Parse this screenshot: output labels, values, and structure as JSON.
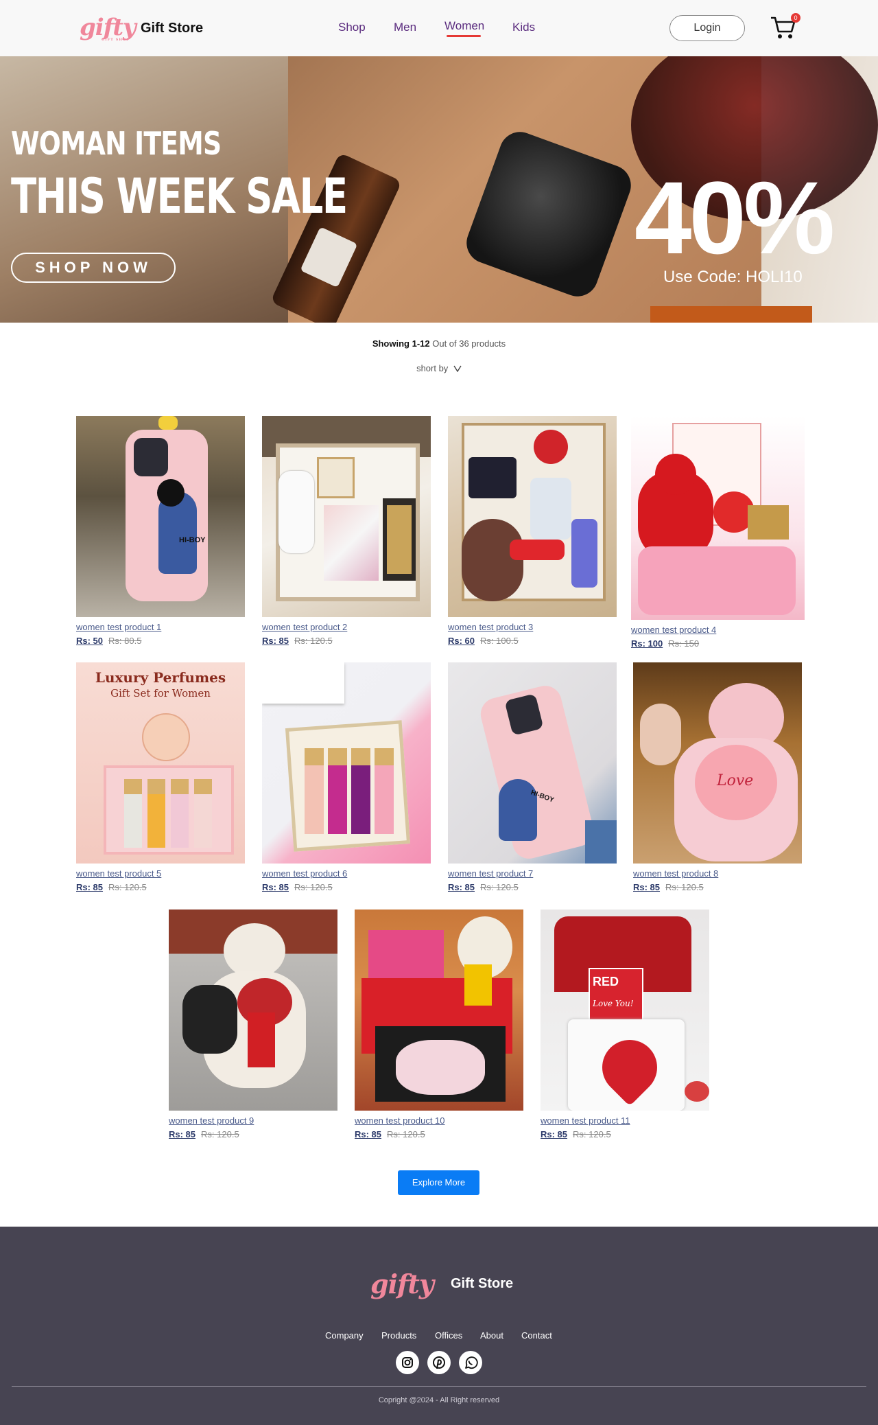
{
  "header": {
    "logo_text": "gifty",
    "logo_tag": "GIFT SHOP",
    "brand": "Gift Store",
    "nav": [
      "Shop",
      "Men",
      "Women",
      "Kids"
    ],
    "active_nav": "Women",
    "login_label": "Login",
    "cart_count": "0",
    "cart_icon": "cart-icon"
  },
  "hero": {
    "line1": "WOMAN ITEMS",
    "line2": "THIS WEEK SALE",
    "cta": "SHOP NOW",
    "discount": "40%",
    "code": "Use Code: HOLI10"
  },
  "listing": {
    "showing_bold": "Showing 1-12",
    "showing_rest": " Out of 36 products",
    "sort_label": "short by",
    "sort_icon": "chevron-down-icon"
  },
  "products": [
    {
      "name": "women test product 1",
      "price": "Rs: 50",
      "old": "Rs: 80.5"
    },
    {
      "name": "women test product 2",
      "price": "Rs: 85",
      "old": "Rs: 120.5"
    },
    {
      "name": "women test product 3",
      "price": "Rs: 60",
      "old": "Rs: 100.5"
    },
    {
      "name": "women test product 4",
      "price": "Rs: 100",
      "old": "Rs: 150"
    },
    {
      "name": "women test product 5",
      "price": "Rs: 85",
      "old": "Rs: 120.5"
    },
    {
      "name": "women test product 6",
      "price": "Rs: 85",
      "old": "Rs: 120.5"
    },
    {
      "name": "women test product 7",
      "price": "Rs: 85",
      "old": "Rs: 120.5"
    },
    {
      "name": "women test product 8",
      "price": "Rs: 85",
      "old": "Rs: 120.5"
    },
    {
      "name": "women test product 9",
      "price": "Rs: 85",
      "old": "Rs: 120.5"
    },
    {
      "name": "women test product 10",
      "price": "Rs: 85",
      "old": "Rs: 120.5"
    },
    {
      "name": "women test product 11",
      "price": "Rs: 85",
      "old": "Rs: 120.5"
    }
  ],
  "product_art": {
    "p5_title": "Luxury Perfumes",
    "p5_sub": "Gift Set for Women",
    "p1_text": "HI-BOY",
    "p7_text": "HI-BOY",
    "p8_text": "Love",
    "p11_line1": "RED",
    "p11_line2": "Love You!"
  },
  "explore_label": "Explore More",
  "footer": {
    "logo_text": "gifty",
    "brand": "Gift Store",
    "links": [
      "Company",
      "Products",
      "Offices",
      "About",
      "Contact"
    ],
    "social_icons": [
      "instagram-icon",
      "pinterest-icon",
      "whatsapp-icon"
    ],
    "copyright": "Copright @2024 - All Right reserved"
  },
  "colors": {
    "accent_pink": "#f0879b",
    "nav_purple": "#5a2b7e",
    "active_underline": "#e53935",
    "explore_blue": "#0a7cf5",
    "footer_bg": "#474452"
  }
}
